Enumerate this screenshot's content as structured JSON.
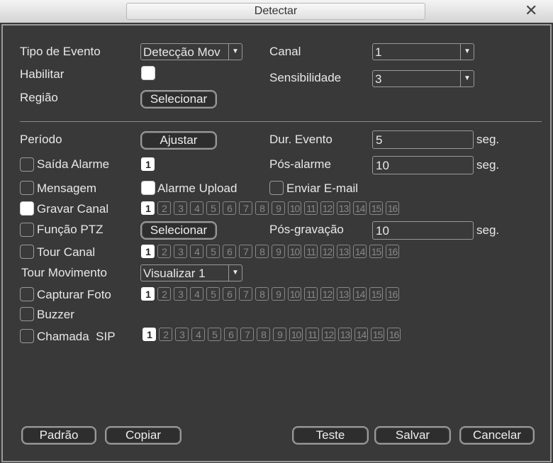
{
  "window": {
    "title": "Detectar",
    "close": "✕"
  },
  "labels": {
    "tipo_evento": "Tipo de Evento",
    "habilitar": "Habilitar",
    "regiao": "Região",
    "canal": "Canal",
    "sensibilidade": "Sensibilidade",
    "periodo": "Período",
    "dur_evento": "Dur. Evento",
    "saida_alarme": "Saída Alarme",
    "pos_alarme": "Pós-alarme",
    "mensagem": "Mensagem",
    "alarme_upload": "Alarme Upload",
    "enviar_email": "Enviar E-mail",
    "gravar_canal": "Gravar Canal",
    "funcao_ptz": "Função PTZ",
    "pos_gravacao": "Pós-gravação",
    "tour_canal": "Tour Canal",
    "tour_movimento": "Tour Movimento",
    "capturar_foto": "Capturar Foto",
    "buzzer": "Buzzer",
    "chamada_sip": "Chamada  SIP",
    "seg": "seg."
  },
  "values": {
    "tipo_evento": "Detecção Mov",
    "canal": "1",
    "sensibilidade": "3",
    "dur_evento": "5",
    "pos_alarme": "10",
    "pos_gravacao": "10",
    "tour_movimento": "Visualizar 1",
    "saida_alarme_channel": "1"
  },
  "checked": {
    "habilitar": true,
    "saida_alarme": false,
    "mensagem": false,
    "alarme_upload": true,
    "enviar_email": false,
    "gravar_canal": true,
    "funcao_ptz": false,
    "tour_canal": false,
    "capturar_foto": false,
    "buzzer": false,
    "chamada_sip": false
  },
  "channels": [
    "1",
    "2",
    "3",
    "4",
    "5",
    "6",
    "7",
    "8",
    "9",
    "10",
    "11",
    "12",
    "13",
    "14",
    "15",
    "16"
  ],
  "selected_channel": "1",
  "buttons": {
    "selecionar": "Selecionar",
    "ajustar": "Ajustar",
    "padrao": "Padrão",
    "copiar": "Copiar",
    "teste": "Teste",
    "salvar": "Salvar",
    "cancelar": "Cancelar"
  }
}
